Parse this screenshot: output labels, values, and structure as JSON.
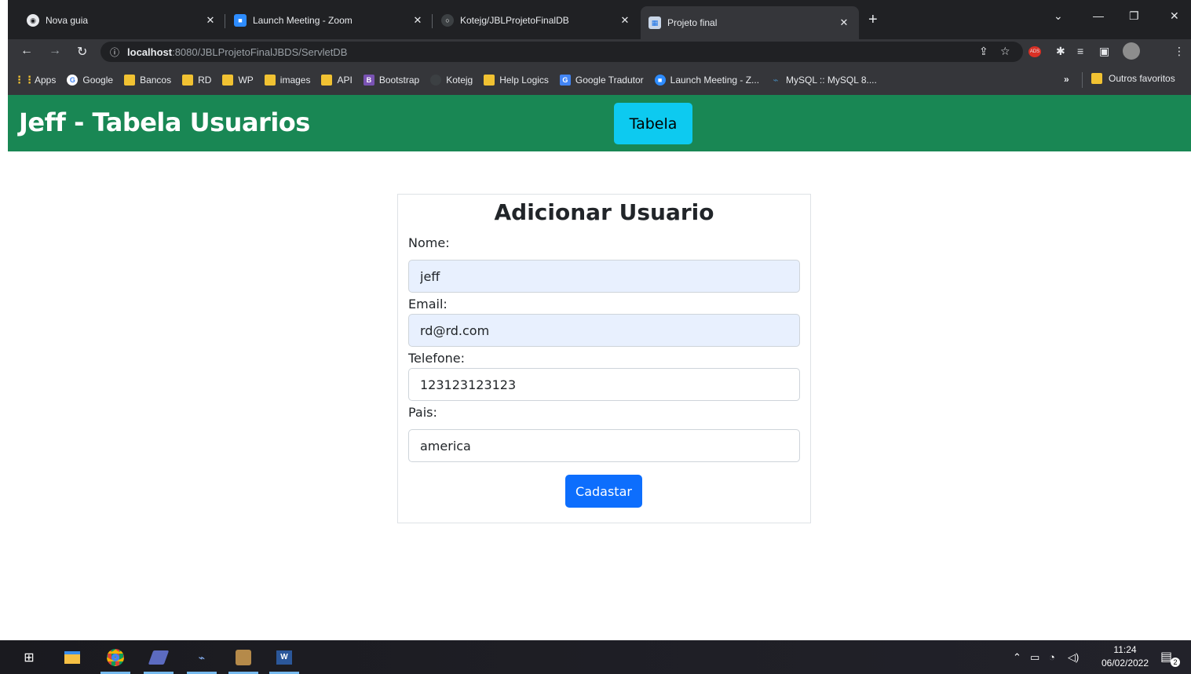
{
  "browser": {
    "tabs": [
      {
        "title": "Nova guia",
        "favicon": "chrome-icon",
        "active": false
      },
      {
        "title": "Launch Meeting - Zoom",
        "favicon": "zoom-icon",
        "active": false
      },
      {
        "title": "Kotejg/JBLProjetoFinalDB",
        "favicon": "github-icon",
        "active": false
      },
      {
        "title": "Projeto final",
        "favicon": "page-icon",
        "active": true
      }
    ],
    "new_tab": "+",
    "url_host": "localhost",
    "url_path": ":8080/JBLProjetoFinalJBDS/ServletDB",
    "bookmarks": [
      {
        "label": "Apps",
        "icon": "apps-grid-icon"
      },
      {
        "label": "Google",
        "icon": "google-icon"
      },
      {
        "label": "Bancos",
        "icon": "folder-icon"
      },
      {
        "label": "RD",
        "icon": "folder-icon"
      },
      {
        "label": "WP",
        "icon": "folder-icon"
      },
      {
        "label": "images",
        "icon": "folder-icon"
      },
      {
        "label": "API",
        "icon": "folder-icon"
      },
      {
        "label": "Bootstrap",
        "icon": "bootstrap-icon"
      },
      {
        "label": "Kotejg",
        "icon": "github-icon"
      },
      {
        "label": "Help Logics",
        "icon": "folder-icon"
      },
      {
        "label": "Google Tradutor",
        "icon": "translate-icon"
      },
      {
        "label": "Launch Meeting - Z...",
        "icon": "zoom-icon"
      },
      {
        "label": "MySQL :: MySQL 8....",
        "icon": "mysql-icon"
      }
    ],
    "bookmarks_more": "»",
    "other_bookmarks": "Outros favoritos"
  },
  "colors": {
    "navbar": "#198754",
    "nav_button": "#0dcaf0",
    "submit_button": "#0d6efd",
    "autofill": "#e8f0fe"
  },
  "navbar": {
    "brand": "Jeff - Tabela Usuarios",
    "button_label": "Tabela"
  },
  "form": {
    "title": "Adicionar Usuario",
    "fields": [
      {
        "label": "Nome:",
        "value": "jeff"
      },
      {
        "label": "Email:",
        "value": "rd@rd.com"
      },
      {
        "label": "Telefone:",
        "value": "123123123123"
      },
      {
        "label": "Pais:",
        "value": "america"
      }
    ],
    "submit_label": "Cadastar"
  },
  "taskbar": {
    "time": "11:24",
    "date": "06/02/2022",
    "notification_count": "2",
    "apps": [
      "windows-start-icon",
      "file-explorer-icon",
      "chrome-icon",
      "eclipse-icon",
      "mysql-workbench-icon",
      "game-icon",
      "word-icon"
    ]
  }
}
